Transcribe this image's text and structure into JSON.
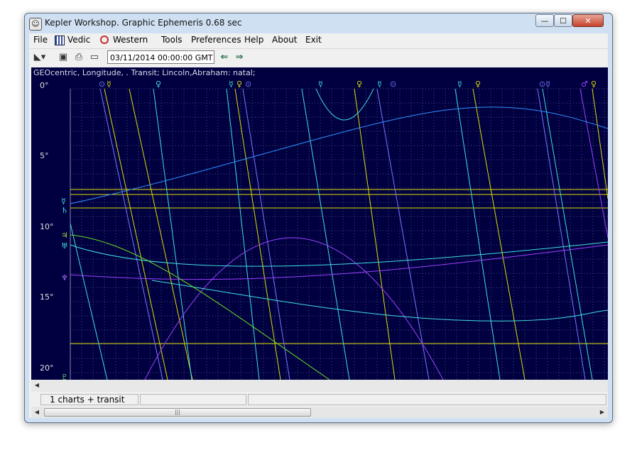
{
  "window": {
    "title": "Kepler Workshop. Graphic Ephemeris   0.68 sec",
    "app_icon": "app-icon",
    "controls": {
      "minimize": "—",
      "maximize": "☐",
      "close": "✕"
    }
  },
  "menu": {
    "file": "File",
    "vedic": "Vedic",
    "western": "Western",
    "tools": "Tools",
    "preferences": "Preferences",
    "help": "Help",
    "about": "About",
    "exit": "Exit"
  },
  "toolbar": {
    "date_time": "03/11/2014   00:00:00  GMT",
    "icons": [
      "palette-icon",
      "camera-icon",
      "printer-icon",
      "card-icon",
      "arrow-left-icon",
      "arrow-right-icon"
    ]
  },
  "chart": {
    "header": "GEOcentric, Longitude, . Transit; Lincoln,Abraham: natal;",
    "y_labels": [
      "0°",
      "5°",
      "10°",
      "15°",
      "20°"
    ],
    "top_glyphs": [
      "⊙",
      "☿",
      "♀",
      "☿",
      "♀",
      "⊙",
      "☿",
      "♀",
      "☿",
      "⊙",
      "☿",
      "♀",
      "⊙☿",
      "♂",
      "♀"
    ],
    "left_glyphs": [
      "☿",
      "♄",
      "♃",
      "♅",
      "♆",
      "♇"
    ],
    "colors": {
      "background": "#000040",
      "sun": "#7777ff",
      "mercury": "#40e0e0",
      "venus": "#dddd00",
      "mars": "#a040ff",
      "curve_blue": "#3090ff",
      "grid": "#4a4a7a"
    }
  },
  "status": {
    "panel1": "1 charts + transit",
    "panel2": "",
    "panel3": ""
  }
}
